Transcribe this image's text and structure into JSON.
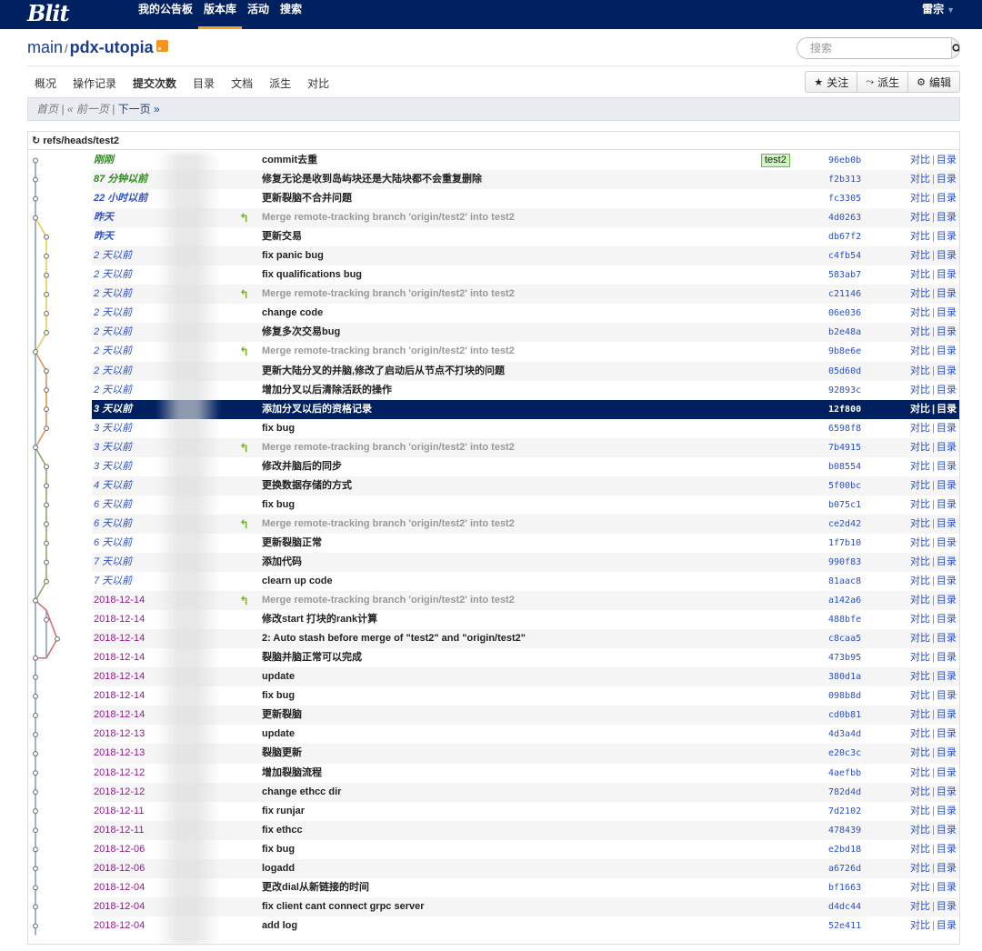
{
  "brand": {
    "logo_text": "Blit"
  },
  "topnav": {
    "items": [
      "我的公告板",
      "版本库",
      "活动",
      "搜索"
    ],
    "active_index": 1
  },
  "user": {
    "name": "雷宗"
  },
  "repo": {
    "project": "main",
    "name": "pdx-utopia"
  },
  "search": {
    "placeholder": "搜索"
  },
  "subnav": {
    "tabs": [
      "概况",
      "操作记录",
      "提交次数",
      "目录",
      "文档",
      "派生",
      "对比"
    ],
    "active_index": 2,
    "actions": [
      {
        "icon": "star-icon",
        "label": "关注"
      },
      {
        "icon": "fork-icon",
        "label": "派生"
      },
      {
        "icon": "gear-icon",
        "label": "编辑"
      }
    ]
  },
  "pager": {
    "first": "首页",
    "prev": "« 前一页",
    "next": "下一页 »"
  },
  "log": {
    "ref": "refs/heads/test2",
    "compare_label": "对比",
    "tree_label": "目录",
    "commits": [
      {
        "date": "刚刚",
        "msg": "commit去重",
        "hash": "96eb0b",
        "badge": "test2",
        "merge": false
      },
      {
        "date": "87 分钟以前",
        "msg": "修复无论是收到岛屿块还是大陆块都不会重复删除",
        "hash": "f2b313",
        "merge": false
      },
      {
        "date": "22 小时以前",
        "msg": "更新裂脑不合并问题",
        "hash": "fc3305",
        "merge": false
      },
      {
        "date": "昨天",
        "msg": "Merge remote-tracking branch 'origin/test2' into test2",
        "hash": "4d0263",
        "merge": true
      },
      {
        "date": "昨天",
        "msg": "更新交易",
        "hash": "db67f2",
        "merge": false
      },
      {
        "date": "2 天以前",
        "msg": "fix panic bug",
        "hash": "c4fb54",
        "merge": false
      },
      {
        "date": "2 天以前",
        "msg": "fix qualifications bug",
        "hash": "583ab7",
        "merge": false
      },
      {
        "date": "2 天以前",
        "msg": "Merge remote-tracking branch 'origin/test2' into test2",
        "hash": "c21146",
        "merge": true
      },
      {
        "date": "2 天以前",
        "msg": "change code",
        "hash": "06e036",
        "merge": false
      },
      {
        "date": "2 天以前",
        "msg": "修复多次交易bug",
        "hash": "b2e48a",
        "merge": false
      },
      {
        "date": "2 天以前",
        "msg": "Merge remote-tracking branch 'origin/test2' into test2",
        "hash": "9b8e6e",
        "merge": true
      },
      {
        "date": "2 天以前",
        "msg": "更新大陆分叉的并脑,修改了启动后从节点不打块的问题",
        "hash": "05d60d",
        "merge": false
      },
      {
        "date": "2 天以前",
        "msg": "增加分叉以后清除活跃的操作",
        "hash": "92893c",
        "merge": false
      },
      {
        "date": "3 天以前",
        "msg": "添加分叉以后的资格记录",
        "hash": "12f800",
        "merge": false,
        "selected": true
      },
      {
        "date": "3 天以前",
        "msg": "fix bug",
        "hash": "6598f8",
        "merge": false
      },
      {
        "date": "3 天以前",
        "msg": "Merge remote-tracking branch 'origin/test2' into test2",
        "hash": "7b4915",
        "merge": true
      },
      {
        "date": "3 天以前",
        "msg": "修改并脑后的同步",
        "hash": "b08554",
        "merge": false
      },
      {
        "date": "4 天以前",
        "msg": "更换数据存储的方式",
        "hash": "5f00bc",
        "merge": false
      },
      {
        "date": "6 天以前",
        "msg": "fix bug",
        "hash": "b075c1",
        "merge": false
      },
      {
        "date": "6 天以前",
        "msg": "Merge remote-tracking branch 'origin/test2' into test2",
        "hash": "ce2d42",
        "merge": true
      },
      {
        "date": "6 天以前",
        "msg": "更新裂脑正常",
        "hash": "1f7b10",
        "merge": false
      },
      {
        "date": "7 天以前",
        "msg": "添加代码",
        "hash": "990f83",
        "merge": false
      },
      {
        "date": "7 天以前",
        "msg": "clearn up code",
        "hash": "81aac8",
        "merge": false
      },
      {
        "date": "2018-12-14",
        "msg": "Merge remote-tracking branch 'origin/test2' into test2",
        "hash": "a142a6",
        "merge": true
      },
      {
        "date": "2018-12-14",
        "msg": "修改start 打块的rank计算",
        "hash": "488bfe",
        "merge": false
      },
      {
        "date": "2018-12-14",
        "msg": "2: Auto stash before merge of \"test2\" and \"origin/test2\"",
        "hash": "c8caa5",
        "merge": false
      },
      {
        "date": "2018-12-14",
        "msg": "裂脑并脑正常可以完成",
        "hash": "473b95",
        "merge": false
      },
      {
        "date": "2018-12-14",
        "msg": "update",
        "hash": "380d1a",
        "merge": false
      },
      {
        "date": "2018-12-14",
        "msg": "fix bug",
        "hash": "098b8d",
        "merge": false
      },
      {
        "date": "2018-12-14",
        "msg": "更新裂脑",
        "hash": "cd0b81",
        "merge": false
      },
      {
        "date": "2018-12-13",
        "msg": "update",
        "hash": "4d3a4d",
        "merge": false
      },
      {
        "date": "2018-12-13",
        "msg": "裂脑更新",
        "hash": "e20c3c",
        "merge": false
      },
      {
        "date": "2018-12-12",
        "msg": "增加裂脑流程",
        "hash": "4aefbb",
        "merge": false
      },
      {
        "date": "2018-12-12",
        "msg": "change ethcc dir",
        "hash": "782d4d",
        "merge": false
      },
      {
        "date": "2018-12-11",
        "msg": "fix runjar",
        "hash": "7d2102",
        "merge": false
      },
      {
        "date": "2018-12-11",
        "msg": "fix ethcc",
        "hash": "478439",
        "merge": false
      },
      {
        "date": "2018-12-06",
        "msg": "fix bug",
        "hash": "e2bd18",
        "merge": false
      },
      {
        "date": "2018-12-06",
        "msg": "logadd",
        "hash": "a6726d",
        "merge": false
      },
      {
        "date": "2018-12-04",
        "msg": "更改dial从新链接的时间",
        "hash": "bf1663",
        "merge": false
      },
      {
        "date": "2018-12-04",
        "msg": "fix client cant connect grpc server",
        "hash": "d4dc44",
        "merge": false
      },
      {
        "date": "2018-12-04",
        "msg": "add log",
        "hash": "52e411",
        "merge": false
      }
    ]
  },
  "graph_colors": {
    "main": "#7d9cc4",
    "yellow": "#e6c84a",
    "orange": "#d9914a",
    "green": "#8aa35a",
    "red": "#d46a6a"
  }
}
